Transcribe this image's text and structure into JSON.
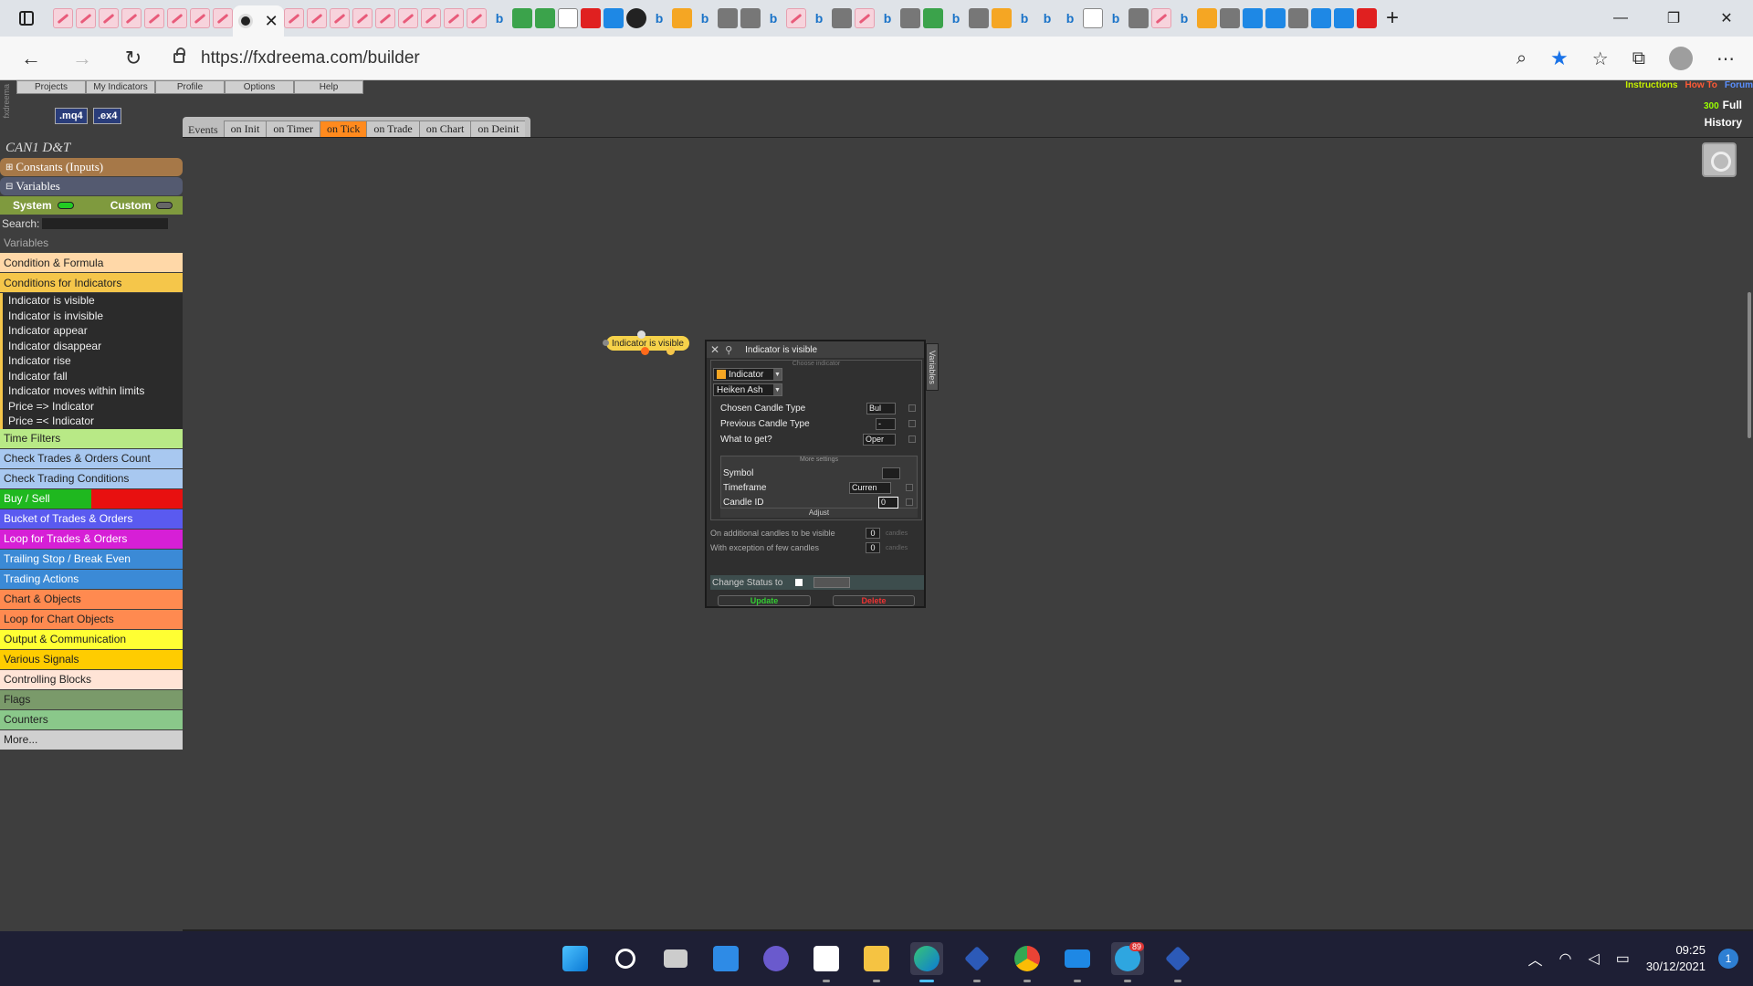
{
  "browser": {
    "url": "https://fxdreema.com/builder"
  },
  "app": {
    "menu": [
      "Projects",
      "My Indicators",
      "Profile",
      "Options",
      "Help"
    ],
    "side_label": "fxdreema",
    "mq4_label": ".mq4",
    "ex4_label": ".ex4",
    "instructions": "Instructions",
    "howto": "How To",
    "forum": "Forum",
    "count": "300",
    "full": "Full",
    "history": "History",
    "events": {
      "label": "Events",
      "tabs": [
        "on Init",
        "on Timer",
        "on Tick",
        "on Trade",
        "on Chart",
        "on Deinit"
      ],
      "active": "on Tick"
    }
  },
  "sidebar": {
    "project_title": "CAN1 D&T",
    "constants": "Constants (Inputs)",
    "variables_bar": "Variables",
    "system": "System",
    "custom": "Custom",
    "search_label": "Search:",
    "variables_header": "Variables",
    "cat_condition": "Condition & Formula",
    "cat_conditions_ind": "Conditions for Indicators",
    "sub_items": [
      "Indicator is visible",
      "Indicator is invisible",
      "Indicator appear",
      "Indicator disappear",
      "Indicator rise",
      "Indicator fall",
      "Indicator moves within limits",
      "Price => Indicator",
      "Price =< Indicator"
    ],
    "categories": [
      {
        "label": "Time Filters",
        "bg": "#b8e986",
        "color": "#222"
      },
      {
        "label": "Check Trades & Orders Count",
        "bg": "#a8c8f0",
        "color": "#222"
      },
      {
        "label": "Check Trading Conditions",
        "bg": "#a8c8f0",
        "color": "#222"
      },
      {
        "label": "Buy / Sell",
        "bg": "linear-gradient(90deg,#1fb81f 50%,#e81010 50%)",
        "color": "#fff"
      },
      {
        "label": "Bucket of Trades & Orders",
        "bg": "#5a5af0",
        "color": "#fff"
      },
      {
        "label": "Loop for Trades & Orders",
        "bg": "#d61fd6",
        "color": "#fff"
      },
      {
        "label": "Trailing Stop / Break Even",
        "bg": "#3b8ad6",
        "color": "#fff"
      },
      {
        "label": "Trading Actions",
        "bg": "#3b8ad6",
        "color": "#fff"
      },
      {
        "label": "Chart & Objects",
        "bg": "#ff8a50",
        "color": "#222"
      },
      {
        "label": "Loop for Chart Objects",
        "bg": "#ff8a50",
        "color": "#222"
      },
      {
        "label": "Output & Communication",
        "bg": "#ffff33",
        "color": "#222"
      },
      {
        "label": "Various Signals",
        "bg": "#ffcc00",
        "color": "#222"
      },
      {
        "label": "Controlling Blocks",
        "bg": "#ffe4d6",
        "color": "#222"
      },
      {
        "label": "Flags",
        "bg": "#7a9a6a",
        "color": "#222"
      },
      {
        "label": "Counters",
        "bg": "#8ac88a",
        "color": "#222"
      },
      {
        "label": "More...",
        "bg": "#d0d0d0",
        "color": "#222"
      }
    ]
  },
  "block": {
    "label": "Indicator is visible"
  },
  "dialog": {
    "title": "Indicator is visible",
    "vars_tab": "Variables",
    "choose_label": "Choose indicator",
    "indicator": "Indicator",
    "indicator_name": "Heiken Ash",
    "chosen_candle_label": "Chosen Candle Type",
    "chosen_candle_value": "Bul",
    "prev_candle_label": "Previous Candle Type",
    "prev_candle_value": "-",
    "what_get_label": "What to get?",
    "what_get_value": "Oper",
    "more_settings": "More settings",
    "symbol_label": "Symbol",
    "timeframe_label": "Timeframe",
    "timeframe_value": "Curren",
    "candle_id_label": "Candle ID",
    "candle_id_value": "0",
    "adjust": "Adjust",
    "additional_label": "On additional candles to be visible",
    "additional_value": "0",
    "exception_label": "With exception of few candles",
    "exception_value": "0",
    "candles_unit": "candles",
    "change_status": "Change Status to",
    "update": "Update",
    "delete": "Delete"
  },
  "taskbar": {
    "telegram_badge": "89",
    "time": "09:25",
    "date": "30/12/2021",
    "notifications": "1"
  }
}
